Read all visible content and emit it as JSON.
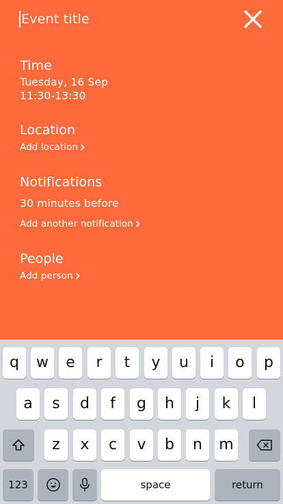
{
  "header": {
    "title_placeholder": "Event title"
  },
  "sections": {
    "time": {
      "title": "Time",
      "date": "Tuesday, 16 Sep",
      "range": "11:30-13:30"
    },
    "location": {
      "title": "Location",
      "add_label": "Add location"
    },
    "notifications": {
      "title": "Notifications",
      "value": "30 minutes before",
      "add_label": "Add another notification"
    },
    "people": {
      "title": "People",
      "add_label": "Add person"
    }
  },
  "keyboard": {
    "row1": [
      "q",
      "w",
      "e",
      "r",
      "t",
      "y",
      "u",
      "i",
      "o",
      "p"
    ],
    "row2": [
      "a",
      "s",
      "d",
      "f",
      "g",
      "h",
      "j",
      "k",
      "l"
    ],
    "row3": [
      "z",
      "x",
      "c",
      "v",
      "b",
      "n",
      "m"
    ],
    "numbers_label": "123",
    "space_label": "space",
    "return_label": "return"
  },
  "colors": {
    "accent": "#FF6A3D",
    "keyboard_bg": "#D3D6DC",
    "key_bg": "#FFFFFF",
    "key_gray": "#ADB3BC"
  },
  "icons": {
    "close": "close-icon",
    "shift": "shift-icon",
    "delete": "delete-icon",
    "emoji": "emoji-icon",
    "mic": "microphone-icon",
    "chevron": "chevron-right-icon"
  }
}
